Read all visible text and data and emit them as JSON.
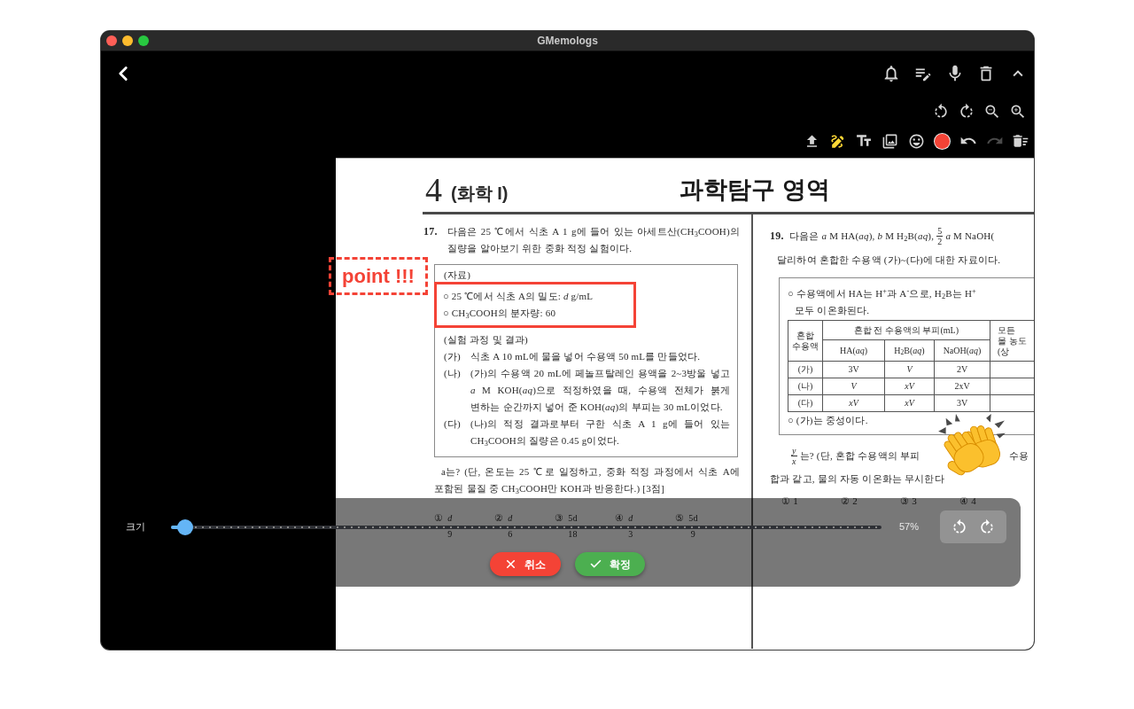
{
  "window": {
    "title": "GMemologs"
  },
  "drawing_toolbar": {
    "pen_selected": true,
    "redo_disabled": true
  },
  "document": {
    "page_number": "4",
    "subject": "(화학 I)",
    "section_title": "과학탐구 영역",
    "annotation": "point !!!",
    "question_17": {
      "number": "17.",
      "stem": "다음은 25 ℃에서 식초 A 1 g에 들어 있는 아세트산(CH$_{3}$COOH)의 질량을 알아보기 위한 중화 적정 실험이다.",
      "data_heading": "(자료)",
      "data_items": [
        "○ 25 ℃에서 식초 A의 밀도: *d* g/mL",
        "○ CH$_{3}$COOH의 분자량: 60"
      ],
      "experiment_heading": "(실험 과정 및 결과)",
      "steps": [
        {
          "label": "(가)",
          "text": "식초 A 10 mL에 물을 넣어 수용액 50 mL를 만들었다."
        },
        {
          "label": "(나)",
          "text": "(가)의 수용액 20 mL에 페놀프탈레인 용액을 2~3방울 넣고 *a* M KOH(*aq*)으로 적정하였을 때, 수용액 전체가 붉게 변하는 순간까지 넣어 준 KOH(*aq*)의 부피는 30 mL이었다."
        },
        {
          "label": "(다)",
          "text": "(나)의 적정 결과로부터 구한 식초 A 1 g에 들어 있는 CH$_{3}$COOH의 질량은 0.45 g이었다."
        }
      ],
      "prompt": "a는? (단, 온도는 25 ℃로 일정하고, 중화 적정 과정에서 식초 A에 포함된 물질 중 CH$_{3}$COOH만 KOH과 반응한다.) [3점]",
      "choices": [
        {
          "mark": "①",
          "numerator": "*d*",
          "denominator": "9"
        },
        {
          "mark": "②",
          "numerator": "*d*",
          "denominator": "6"
        },
        {
          "mark": "③",
          "numerator": "5d",
          "denominator": "18"
        },
        {
          "mark": "④",
          "numerator": "*d*",
          "denominator": "3"
        },
        {
          "mark": "⑤",
          "numerator": "5d",
          "denominator": "9"
        }
      ]
    },
    "question_19": {
      "number": "19.",
      "stem_lines": [
        [
          {
            "kind": "text",
            "text": "다음은 *a* M HA(*aq*), *b* M H$_{2}$B(*aq*),"
          },
          {
            "kind": "fraction",
            "numerator": "5",
            "denominator": "2"
          },
          {
            "kind": "text",
            "text": "*a* M NaOH("
          }
        ],
        [
          {
            "kind": "text",
            "text": "달리하여 혼합한 수용액 (가)~(다)에 대한 자료이다."
          }
        ]
      ],
      "condition_lines": [
        "○ 수용액에서 HA는 H$^{+}$과 A$^{-}$으로, H$_{2}$B는 H$^{+}$",
        "모두 이온화된다."
      ],
      "table": {
        "row_header": "혼합 수용액",
        "group_header": "혼합 전 수용액의 부피(mL)",
        "columns": [
          "HA(*aq*)",
          "H$_{2}$B(*aq*)",
          "NaOH(*aq*)"
        ],
        "column_5": [
          "모든",
          "몰 농도",
          "(상"
        ],
        "rows": [
          {
            "label": "(가)",
            "cells": [
              "3V",
              "*V*",
              "2V"
            ]
          },
          {
            "label": "(나)",
            "cells": [
              "*V*",
              "*xV*",
              "2xV"
            ]
          },
          {
            "label": "(다)",
            "cells": [
              "*xV*",
              "*xV*",
              "3V"
            ]
          }
        ]
      },
      "note": "○ (가)는 중성이다.",
      "prompt_lines": [
        [
          {
            "kind": "fraction",
            "numerator": "*y*",
            "denominator": "*x*"
          },
          {
            "kind": "text",
            "text": "는? (단, 혼합 수용액의 부피"
          },
          {
            "kind": "sticker"
          },
          {
            "kind": "text",
            "text": "수용"
          }
        ],
        [
          {
            "kind": "text",
            "text": "합과 같고, 물의 자동 이온화는 무시한다"
          }
        ]
      ],
      "choices": [
        "① 1",
        "② 2",
        "③ 3",
        "④ 4"
      ]
    }
  },
  "resize_panel": {
    "label": "크기",
    "level": 0.02,
    "reading": "57%",
    "buttons": [
      {
        "kind": "cancel",
        "label": "취소"
      },
      {
        "kind": "confirm",
        "label": "확정"
      }
    ]
  }
}
